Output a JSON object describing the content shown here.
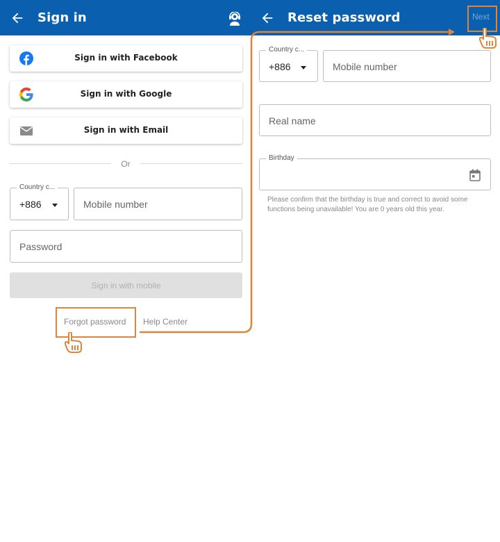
{
  "left": {
    "title": "Sign in",
    "social": {
      "facebook": "Sign in with Facebook",
      "google": "Sign in with Google",
      "email": "Sign in with Email"
    },
    "or": "Or",
    "country_label": "Country c...",
    "country_value": "+886",
    "mobile_placeholder": "Mobile number",
    "password_placeholder": "Password",
    "signin_button": "Sign in with mobile",
    "forgot": "Forgot password",
    "help": "Help Center"
  },
  "right": {
    "title": "Reset password",
    "next": "Next",
    "country_label": "Country c...",
    "country_value": "+886",
    "mobile_placeholder": "Mobile number",
    "realname_placeholder": "Real name",
    "birthday_label": "Birthday",
    "hint": "Please confirm that the birthday is true and correct to avoid some functions being unavailable! You are 0 years old this year."
  },
  "colors": {
    "appbar": "#0a5fae",
    "highlight": "#e0843a",
    "facebook": "#1877f2"
  },
  "icons": [
    "back-arrow-icon",
    "support-agent-icon",
    "facebook-icon",
    "google-icon",
    "email-icon",
    "dropdown-caret-icon",
    "calendar-icon",
    "pointer-hand-icon"
  ]
}
